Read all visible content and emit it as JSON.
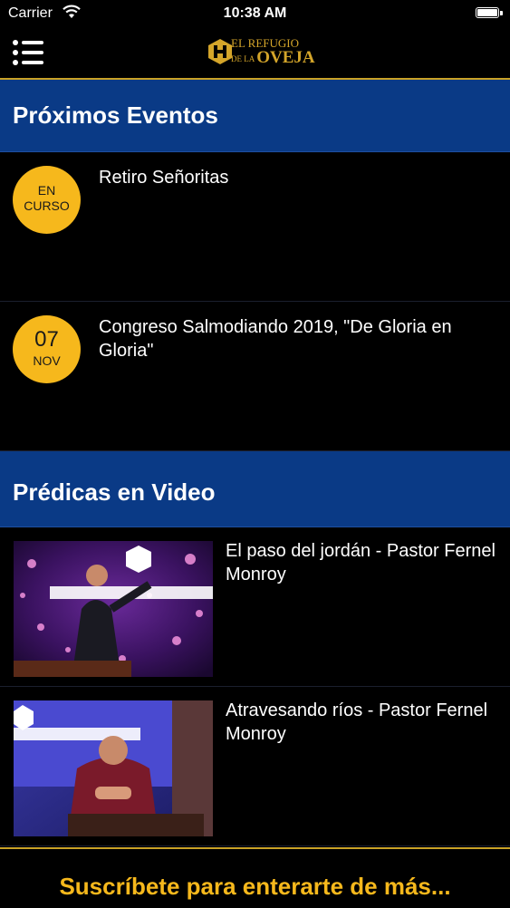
{
  "status_bar": {
    "carrier": "Carrier",
    "time": "10:38 AM"
  },
  "header": {
    "logo_line1": "EL REFUGIO",
    "logo_line2_small": "DE LA",
    "logo_line2": "OVEJA"
  },
  "events_section": {
    "title": "Próximos Eventos"
  },
  "events": [
    {
      "badge_top": "EN",
      "badge_bottom": "CURSO",
      "title": "Retiro Señoritas"
    },
    {
      "badge_top": "07",
      "badge_bottom": "NOV",
      "title": "Congreso Salmodiando 2019, \"De Gloria en Gloria\""
    }
  ],
  "videos_section": {
    "title": "Prédicas en Video"
  },
  "videos": [
    {
      "title": "El paso del jordán - Pastor Fernel Monroy"
    },
    {
      "title": "Atravesando ríos - Pastor Fernel Monroy"
    }
  ],
  "footer": {
    "label": "Suscríbete para enterarte de más..."
  },
  "colors": {
    "accent": "#f6b81c",
    "header_blue": "#0a3a86",
    "gold": "#c9a227"
  }
}
